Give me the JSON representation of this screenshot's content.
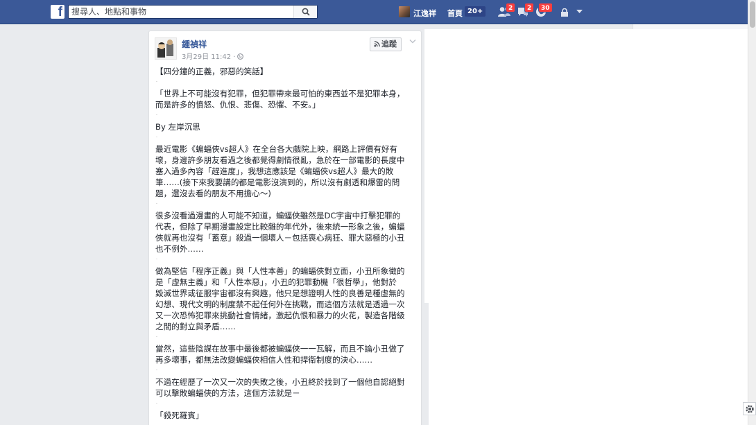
{
  "topbar": {
    "logo": "f",
    "search_placeholder": "搜尋人、地點和事物",
    "user_name": "江逸祥",
    "home_label": "首頁",
    "home_count": "20+",
    "friend_requests_badge": "2",
    "messages_badge": "2",
    "notifications_badge": "30"
  },
  "post": {
    "author": "鍾禎祥",
    "timestamp": "3月29日 11:42 ·",
    "follow_label": "追蹤",
    "paragraphs": [
      "【四分鐘的正義，邪惡的笑話】",
      "「世界上不可能沒有犯罪，但犯罪帶來最可怕的東西並不是犯罪本身，\n而是許多的憤怒、仇恨、悲傷、恐懼、不安。」",
      "By 左岸沉思",
      "最近電影《蝙蝠俠vs超人》在全台各大戲院上映，網路上評價有好有\n壞，身邊許多朋友看過之後都覺得劇情很亂，急於在一部電影的長度中\n塞入過多內容「趕進度」，我想這應該是《蝙蝠俠vs超人》最大的敗\n筆……(接下來我要講的都是電影沒演到的，所以沒有劇透和爆雷的問\n題，還沒去看的朋友不用擔心～)",
      "很多沒看過漫畫的人可能不知道，蝙蝠俠雖然是DC宇宙中打擊犯罪的\n代表，但除了早期漫畫設定比較雜的年代外，後來統一形象之後，蝙蝠\n俠就再也沒有「蓄意」殺過一個壞人－包括喪心病狂、罪大惡極的小丑\n也不例外……",
      "做為堅信「程序正義」與「人性本善」的蝙蝠俠對立面，小丑所象徵的\n是「虛無主義」和「人性本惡」，小丑的犯罪動機「很哲學」，他對於\n毀滅世界或征服宇宙都沒有興趣，他只是想證明人性的良善是種虛無的\n幻想、現代文明的制度禁不起任何外在挑戰，而這個方法就是透過一次\n又一次恐怖犯罪來挑動社會情緒，激起仇恨和暴力的火花，製造各階級\n之間的對立與矛盾……",
      "當然，這些陰謀在故事中最後都被蝙蝠俠一一瓦解，而且不論小丑做了\n再多壞事，都無法改變蝙蝠俠相信人性和捍衛制度的決心……",
      "不過在經歷了一次又一次的失敗之後，小丑終於找到了一個他自認絕對\n可以擊敗蝙蝠俠的方法，這個方法就是－",
      "「殺死羅賓」"
    ],
    "separator": "."
  },
  "colors": {
    "facebook_blue": "#3b5998",
    "link_blue": "#365899",
    "badge_red": "#fa3e3e"
  },
  "icons": [
    "facebook-logo-icon",
    "search-icon",
    "friends-icon",
    "messages-icon",
    "globe-icon",
    "lock-icon",
    "chevron-down-icon",
    "rss-icon",
    "gear-icon"
  ]
}
